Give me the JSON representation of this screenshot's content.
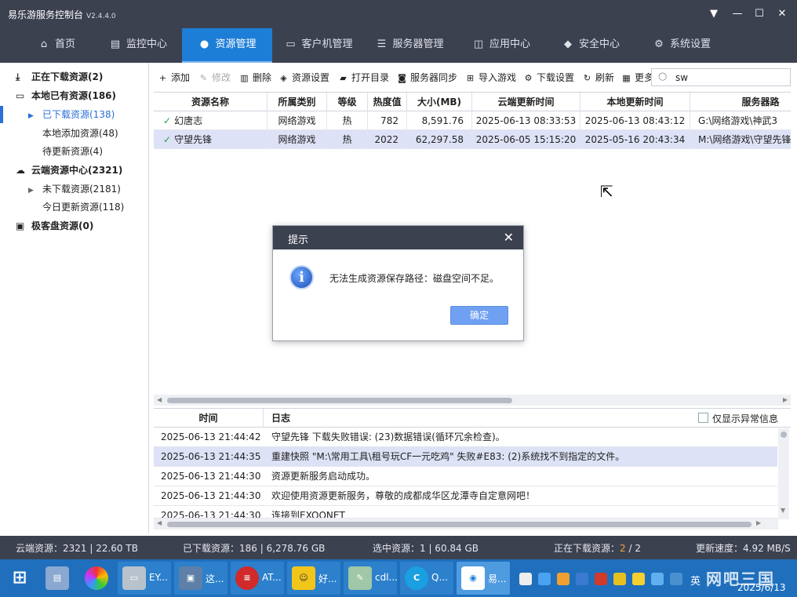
{
  "window": {
    "title": "易乐游服务控制台",
    "version": "V2.4.4.0"
  },
  "nav": {
    "tabs": [
      {
        "label": "首页",
        "icon": "home-icon"
      },
      {
        "label": "监控中心",
        "icon": "chart-icon"
      },
      {
        "label": "资源管理",
        "icon": "gamepad-icon"
      },
      {
        "label": "客户机管理",
        "icon": "monitor-icon"
      },
      {
        "label": "服务器管理",
        "icon": "server-icon"
      },
      {
        "label": "应用中心",
        "icon": "app-icon"
      },
      {
        "label": "安全中心",
        "icon": "shield-icon"
      },
      {
        "label": "系统设置",
        "icon": "gear-icon"
      }
    ],
    "active_index": 2
  },
  "sidebar": {
    "items": [
      {
        "label": "正在下载资源(2)"
      },
      {
        "label": "本地已有资源(186)"
      },
      {
        "label": "已下载资源(138)"
      },
      {
        "label": "本地添加资源(48)"
      },
      {
        "label": "待更新资源(4)"
      },
      {
        "label": "云端资源中心(2321)"
      },
      {
        "label": "未下载资源(2181)"
      },
      {
        "label": "今日更新资源(118)"
      },
      {
        "label": "极客盘资源(0)"
      }
    ]
  },
  "toolbar": {
    "add": "添加",
    "edit": "修改",
    "delete": "删除",
    "res_settings": "资源设置",
    "open_dir": "打开目录",
    "server_sync": "服务器同步",
    "import_game": "导入游戏",
    "download_settings": "下载设置",
    "refresh": "刷新",
    "more": "更多"
  },
  "search": {
    "value": "sw"
  },
  "grid": {
    "columns": [
      "资源名称",
      "所属类别",
      "等级",
      "热度值",
      "大小(MB)",
      "云端更新时间",
      "本地更新时间",
      "服务器路"
    ],
    "rows": [
      {
        "name": "幻唐志",
        "category": "网络游戏",
        "level": "热",
        "heat": "782",
        "size": "8,591.76",
        "cloud_time": "2025-06-13 08:33:53",
        "local_time": "2025-06-13 08:43:12",
        "path": "G:\\网络游戏\\神武3"
      },
      {
        "name": "守望先锋",
        "category": "网络游戏",
        "level": "热",
        "heat": "2022",
        "size": "62,297.58",
        "cloud_time": "2025-06-05 15:15:20",
        "local_time": "2025-05-16 20:43:34",
        "path": "M:\\网络游戏\\守望先锋"
      }
    ]
  },
  "log": {
    "col_time": "时间",
    "col_log": "日志",
    "only_errors": "仅显示异常信息",
    "rows": [
      {
        "time": "2025-06-13 21:44:42",
        "msg": "守望先锋 下载失败错误: (23)数据错误(循环冗余检查)。"
      },
      {
        "time": "2025-06-13 21:44:35",
        "msg": "重建快照 \"M:\\常用工具\\租号玩CF一元吃鸡\" 失败#E83: (2)系统找不到指定的文件。"
      },
      {
        "time": "2025-06-13 21:44:30",
        "msg": "资源更新服务启动成功。"
      },
      {
        "time": "2025-06-13 21:44:30",
        "msg": "欢迎使用资源更新服务，尊敬的成都成华区龙潭寺自定意网吧！"
      },
      {
        "time": "2025-06-13 21:44:30",
        "msg": "连接到EXOONET"
      }
    ]
  },
  "status": {
    "cloud": "云端资源：2321 | 22.60 TB",
    "downloaded": "已下载资源：186 | 6,278.76 GB",
    "selected": "选中资源：1 | 60.84 GB",
    "downloading_label": "正在下载资源：",
    "downloading_current": "2",
    "downloading_total": " / 2",
    "speed": "更新速度：4.92 MB/S"
  },
  "dialog": {
    "title": "提示",
    "message": "无法生成资源保存路径：磁盘空间不足。",
    "ok": "确定"
  },
  "taskbar": {
    "apps": [
      {
        "label": "EY..."
      },
      {
        "label": "这..."
      },
      {
        "label": "AT..."
      },
      {
        "label": "好..."
      },
      {
        "label": "cdl..."
      },
      {
        "label": "Q..."
      },
      {
        "label": "易..."
      }
    ],
    "ime": "英",
    "date": "2025/6/13",
    "watermark": "网吧三国"
  }
}
